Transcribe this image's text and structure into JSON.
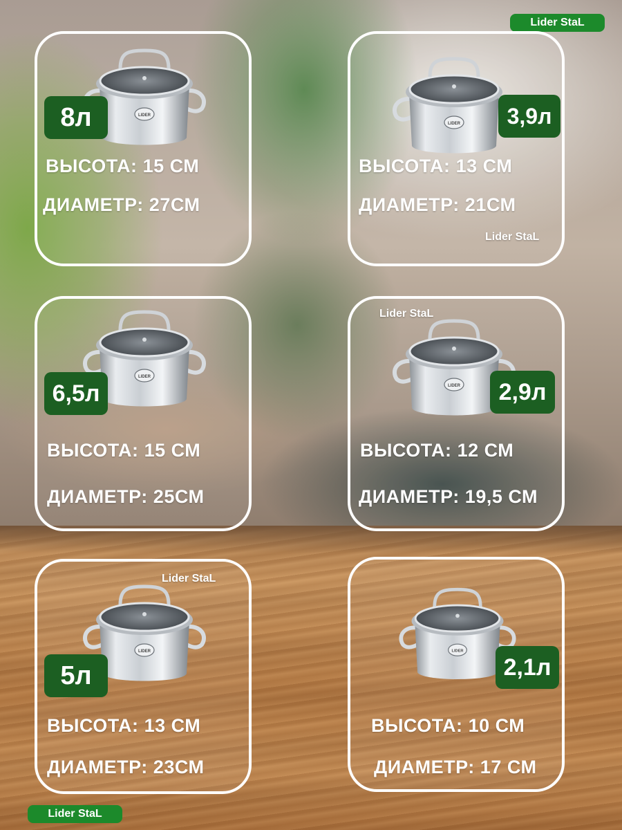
{
  "brand": {
    "watermark": "Lider StaL",
    "pot_logo": "LIDER"
  },
  "colors": {
    "badge_green": "#1c5f22",
    "pill_green": "#1c8a2b",
    "card_border": "#ffffff"
  },
  "products": [
    {
      "volume": "8л",
      "height_label": "ВЫСОТА:",
      "height_value": "15 СМ",
      "diameter_label": "ДИАМЕТР:",
      "diameter_value": "27СМ"
    },
    {
      "volume": "3,9л",
      "height_label": "ВЫСОТА:",
      "height_value": "13 СМ",
      "diameter_label": "ДИАМЕТР:",
      "diameter_value": "21СМ"
    },
    {
      "volume": "6,5л",
      "height_label": "ВЫСОТА:",
      "height_value": "15 СМ",
      "diameter_label": "ДИАМЕТР:",
      "diameter_value": "25СМ"
    },
    {
      "volume": "2,9л",
      "height_label": "ВЫСОТА:",
      "height_value": "12 СМ",
      "diameter_label": "ДИАМЕТР:",
      "diameter_value": "19,5 СМ"
    },
    {
      "volume": "5л",
      "height_label": "ВЫСОТА:",
      "height_value": "13 СМ",
      "diameter_label": "ДИАМЕТР:",
      "diameter_value": "23СМ"
    },
    {
      "volume": "2,1л",
      "height_label": "ВЫСОТА:",
      "height_value": "10 СМ",
      "diameter_label": "ДИАМЕТР:",
      "diameter_value": "17 СМ"
    }
  ]
}
